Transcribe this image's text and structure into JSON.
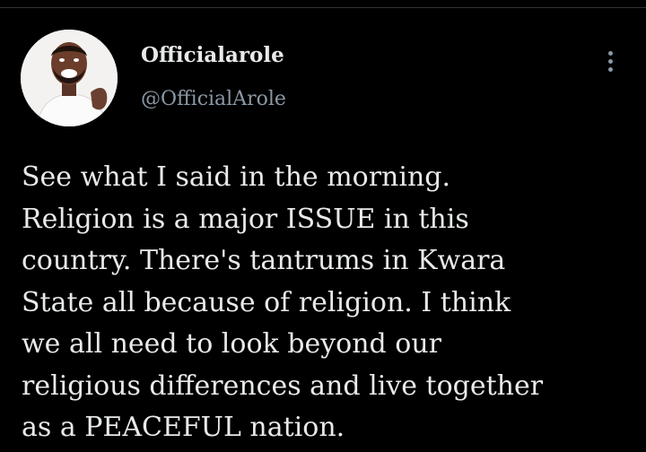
{
  "tweet": {
    "author": {
      "display_name": "Officialarole",
      "handle": "@OfficialArole",
      "avatar_icon": "user-avatar"
    },
    "more_icon": "more-vertical-icon",
    "text": "See what I said in the morning.\nReligion is a major ISSUE in this\ncountry. There's tantrums in Kwara\nState all because of religion. I think\nwe all need to look beyond our\nreligious differences and live together\nas a PEACEFUL nation."
  },
  "colors": {
    "background": "#000000",
    "primary_text": "#e7e9ea",
    "secondary_text": "#8b98a5"
  }
}
